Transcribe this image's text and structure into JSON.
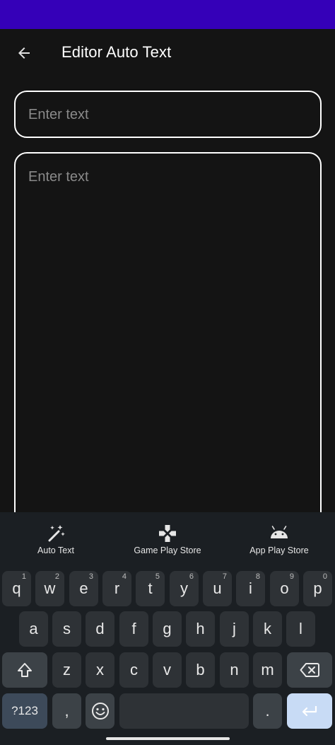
{
  "app_bar": {
    "title": "Editor Auto Text"
  },
  "fields": {
    "title_placeholder": "Enter text",
    "body_placeholder": "Enter text"
  },
  "keyboard_toolbar": [
    {
      "label": "Auto Text",
      "icon": "magic-wand-icon"
    },
    {
      "label": "Game Play Store",
      "icon": "gamepad-icon"
    },
    {
      "label": "App Play Store",
      "icon": "android-icon"
    }
  ],
  "keyboard": {
    "row1": [
      {
        "key": "q",
        "hint": "1"
      },
      {
        "key": "w",
        "hint": "2"
      },
      {
        "key": "e",
        "hint": "3"
      },
      {
        "key": "r",
        "hint": "4"
      },
      {
        "key": "t",
        "hint": "5"
      },
      {
        "key": "y",
        "hint": "6"
      },
      {
        "key": "u",
        "hint": "7"
      },
      {
        "key": "i",
        "hint": "8"
      },
      {
        "key": "o",
        "hint": "9"
      },
      {
        "key": "p",
        "hint": "0"
      }
    ],
    "row2": [
      "a",
      "s",
      "d",
      "f",
      "g",
      "h",
      "j",
      "k",
      "l"
    ],
    "row3": [
      "z",
      "x",
      "c",
      "v",
      "b",
      "n",
      "m"
    ],
    "symbols_label": "?123",
    "comma": ",",
    "period": ".",
    "shift_icon": "shift-icon",
    "backspace_icon": "backspace-icon",
    "emoji_icon": "emoji-icon",
    "enter_icon": "enter-icon"
  },
  "colors": {
    "status_bar": "#3500b8",
    "background": "#141414",
    "keyboard": "#1b1f23",
    "key": "#2e3236",
    "enter_key": "#c8dbf5"
  }
}
